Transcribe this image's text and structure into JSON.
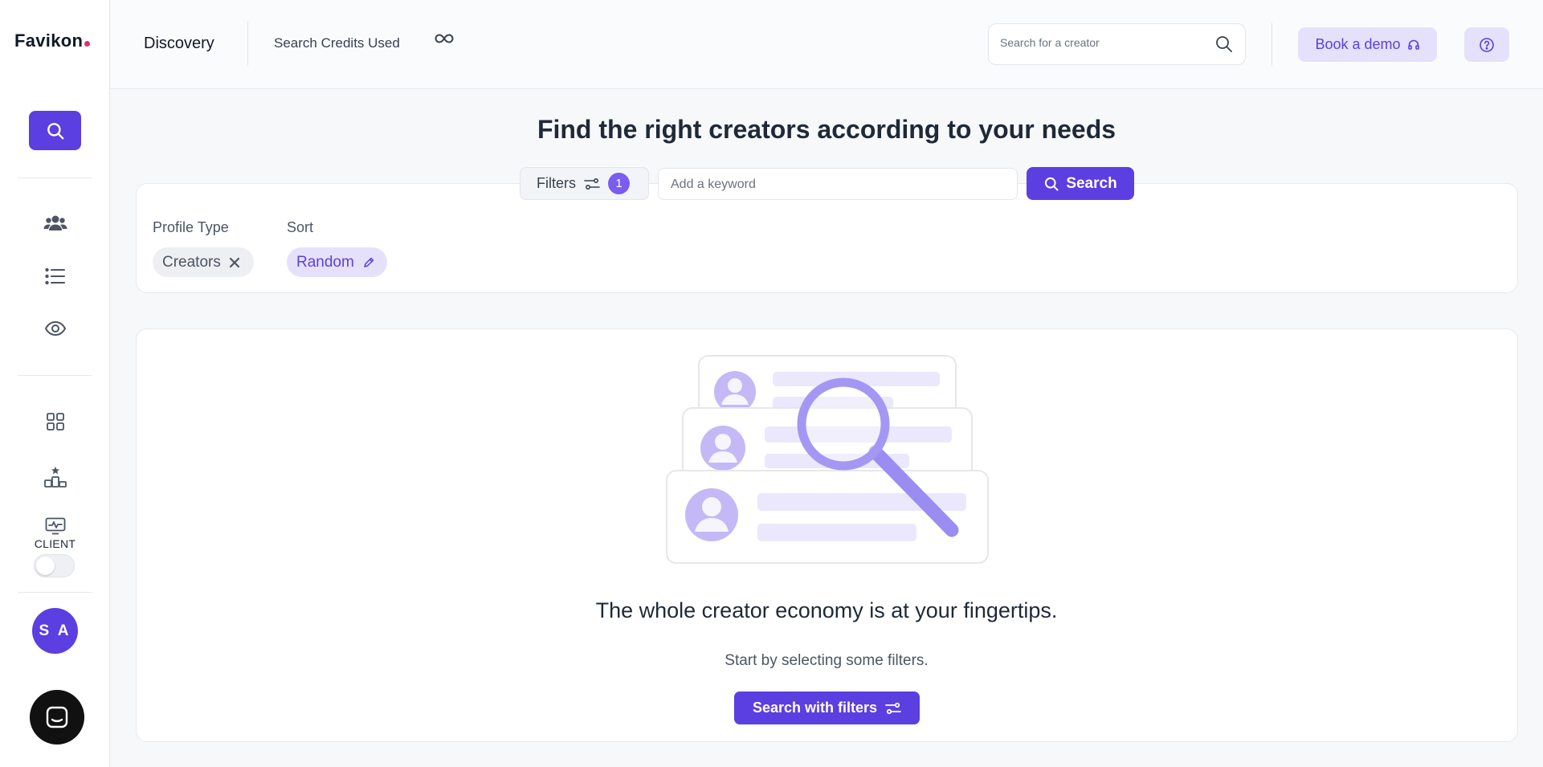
{
  "app": {
    "logo_text": "Favikon",
    "logo_dot_color": "#d6336c",
    "accent": "#5b3fe0"
  },
  "sidebar": {
    "items": [
      {
        "name": "search-icon"
      },
      {
        "name": "users-icon"
      },
      {
        "name": "list-icon"
      },
      {
        "name": "eye-icon"
      },
      {
        "name": "grid-icon"
      },
      {
        "name": "ranking-icon"
      },
      {
        "name": "monitor-icon"
      }
    ],
    "client_label": "CLIENT",
    "client_toggle_on": false,
    "avatar_initials": "S A"
  },
  "topbar": {
    "title": "Discovery",
    "credits_label": "Search Credits Used",
    "credits_value_icon": "infinity-icon",
    "search_placeholder": "Search for a creator",
    "demo_label": "Book a demo"
  },
  "main": {
    "headline": "Find the right creators according to your needs",
    "filters_label": "Filters",
    "filters_count": "1",
    "keyword_placeholder": "Add a keyword",
    "search_label": "Search",
    "profile_type_label": "Profile Type",
    "profile_type_value": "Creators",
    "sort_label": "Sort",
    "sort_value": "Random",
    "empty_title": "The whole creator economy is at your fingertips.",
    "empty_sub": "Start by selecting some filters.",
    "cta_label": "Search with filters"
  }
}
